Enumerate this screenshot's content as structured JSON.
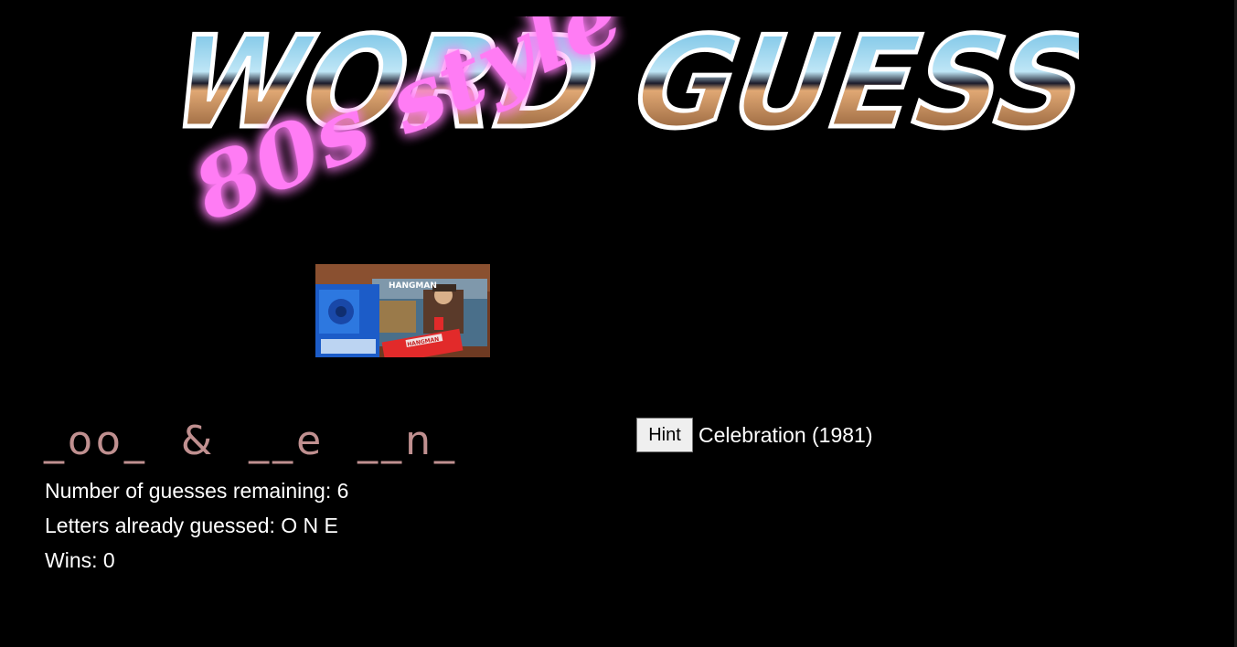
{
  "logo": {
    "word_text": "WORD",
    "guess_text": "GUESS",
    "tagline": "80s style",
    "chrome_sky": "#8fd3f0",
    "chrome_ground": "#c98a55",
    "neon_pink": "#ff5cf0"
  },
  "photo": {
    "box_title": "HANGMAN",
    "booklet_text": "HANGMAN"
  },
  "game": {
    "word_display": "_oo_  &  __e  __n_",
    "guesses_label": "Number of guesses remaining: ",
    "guesses_remaining": "6",
    "letters_label": "Letters already guessed: ",
    "letters_guessed": "O N E",
    "wins_label": "Wins: ",
    "wins": "0"
  },
  "hint": {
    "button_label": "Hint",
    "text": "Celebration (1981)"
  },
  "colors": {
    "background": "#000000",
    "word_color": "#c09090",
    "text_color": "#ffffff"
  }
}
